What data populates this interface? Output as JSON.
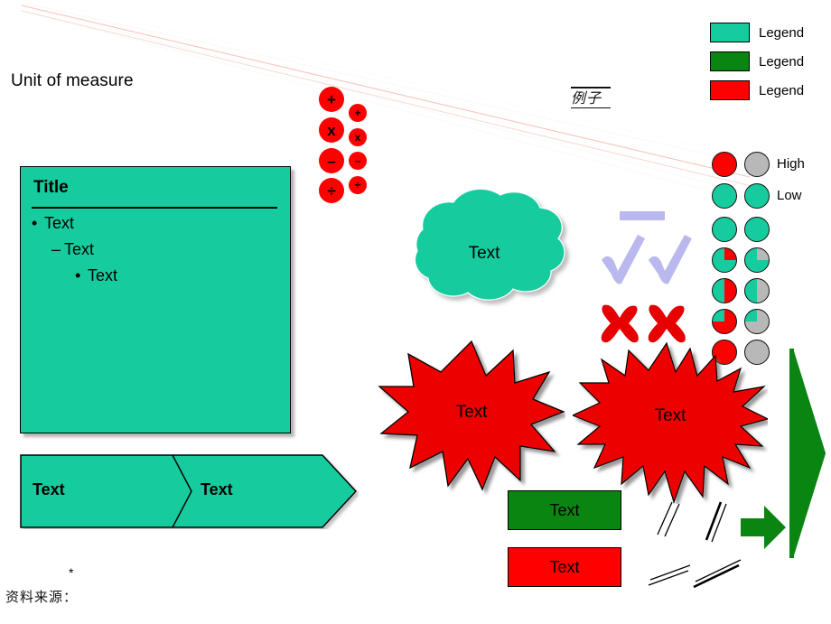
{
  "slide": {
    "unit_of_measure": "Unit of measure",
    "example_stamp": "例子",
    "footnote_asterisk": "*",
    "footnote_source": "资料来源："
  },
  "title_box": {
    "title": "Title",
    "line1": "Text",
    "line2": "Text",
    "line3": "Text",
    "bullet1": "•",
    "bullet2": "–",
    "bullet3": "•",
    "fill_color": "#16CC9E"
  },
  "chevron_banner": {
    "segment1": "Text",
    "segment2": "Text",
    "fill_color": "#16CC9E"
  },
  "math_symbols": {
    "large": [
      "+",
      "x",
      "–",
      "÷"
    ],
    "small": [
      "+",
      "x",
      "–",
      "÷"
    ],
    "fill_color": "#FE0000"
  },
  "cloud": {
    "label": "Text",
    "fill_color": "#16CC9E"
  },
  "explosions": [
    {
      "label": "Text",
      "points": 14,
      "fill_color": "#FE0000"
    },
    {
      "label": "Text",
      "points": 22,
      "fill_color": "#FE0000"
    }
  ],
  "marks": {
    "check_color": "#B9B9EF",
    "cross_color": "#FE0000",
    "bar_color": "#B9B9EF",
    "check_count": 2,
    "cross_count": 2
  },
  "legend": {
    "items": [
      {
        "label": "Legend",
        "color": "#16CC9E"
      },
      {
        "label": "Legend",
        "color": "#0A8511"
      },
      {
        "label": "Legend",
        "color": "#FE0000"
      }
    ]
  },
  "harvey_balls": {
    "label_high": "High",
    "label_low": "Low",
    "base_color": "#16CC9E",
    "left_fill_color": "#FE0000",
    "right_fill_color": "#B8B8B8",
    "rows": [
      {
        "left_pct": 100,
        "right_pct": 100
      },
      {
        "left_pct": 0,
        "right_pct": 0
      },
      {
        "left_pct": 0,
        "right_pct": 0
      },
      {
        "left_pct": 25,
        "right_pct": 25
      },
      {
        "left_pct": 50,
        "right_pct": 50
      },
      {
        "left_pct": 75,
        "right_pct": 75
      },
      {
        "left_pct": 100,
        "right_pct": 100
      }
    ]
  },
  "status_boxes": [
    {
      "label": "Text",
      "color": "#0A8511"
    },
    {
      "label": "Text",
      "color": "#FE0000"
    }
  ],
  "break_marks": {
    "count": 4,
    "color": "#000000"
  },
  "green_arrows": {
    "wedge_color": "#0A8511",
    "arrow_color": "#0A8511"
  },
  "guide_lines": {
    "count": 6,
    "color": "#F7C9C2"
  }
}
